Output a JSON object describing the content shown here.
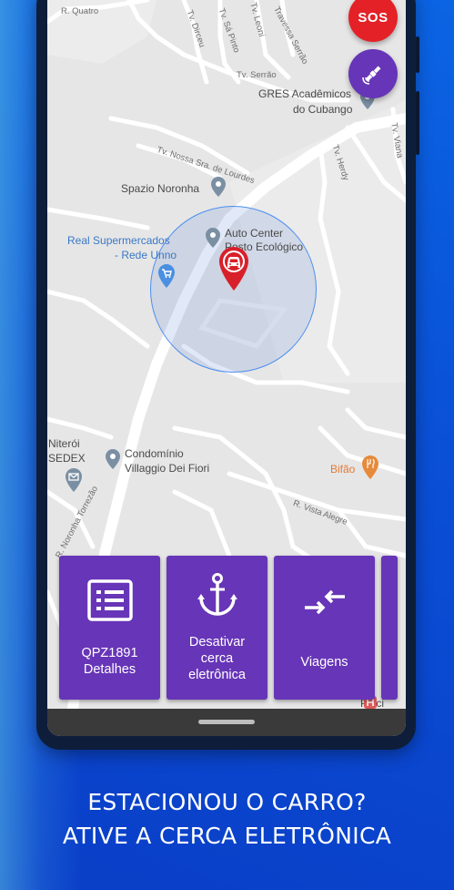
{
  "sos": {
    "label": "SOS"
  },
  "map": {
    "streets": {
      "r_quatro": "R. Quatro",
      "tv_dirceu": "Tv. Dirceu",
      "tv_sa_pinto": "Tv. Sá Pinto",
      "tv_leoni": "Tv. Leoni",
      "travessa_serrao": "Travessa Serrão",
      "tv_serrao": "Tv. Serrão",
      "tv_viana": "Tv. Viana",
      "tv_nossa_sra": "Tv. Nossa Sra. de Lourdes",
      "tv_herdy": "Tv. Herdy",
      "r_vista_alegre": "R. Vista Alegre",
      "r_noronha": "R. Noronha Torrezão"
    },
    "places": {
      "gres": "GRES Acadêmicos",
      "gres_2": "do Cubango",
      "spazio": "Spazio Noronha",
      "auto_center": "Auto Center",
      "auto_center_2": "Posto Ecológico",
      "real_super": "Real Supermercados",
      "real_super_2": "- Rede Unno",
      "niteroi": "Niterói",
      "sedex": "SEDEX",
      "condominio": "Condomínio",
      "condominio_2": "Villaggio Dei Fiori",
      "bifao": "Bifão",
      "placi": "Placi"
    }
  },
  "cards": [
    {
      "line1": "QPZ1891",
      "line2": "Detalhes",
      "icon": "list-icon"
    },
    {
      "line1": "Desativar",
      "line2": "cerca",
      "line3": "eletrônica",
      "icon": "anchor-icon"
    },
    {
      "line1": "Viagens",
      "icon": "arrows-exchange-icon"
    }
  ],
  "headline": {
    "line1": "ESTACIONOU O CARRO?",
    "line2": "ATIVE A CERCA ELETRÔNICA"
  },
  "colors": {
    "purple": "#6735b7",
    "sos_red": "#e32127",
    "geofence_blue": "#4b8ef0",
    "pin_red": "#d8202a"
  }
}
